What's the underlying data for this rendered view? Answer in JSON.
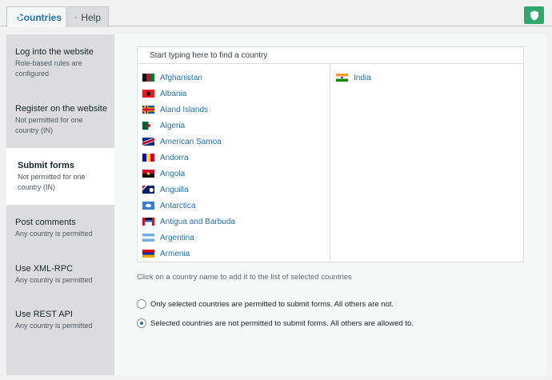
{
  "tabs": {
    "countries_label": "Countries",
    "help_label": "Help"
  },
  "sidebar": {
    "items": [
      {
        "title": "Log into the website",
        "subtitle": "Role-based rules are configured"
      },
      {
        "title": "Register on the website",
        "subtitle": "Not permitted for one country (IN)"
      },
      {
        "title": "Submit forms",
        "subtitle": "Not permitted for one country (IN)"
      },
      {
        "title": "Post comments",
        "subtitle": "Any country is permitted"
      },
      {
        "title": "Use XML-RPC",
        "subtitle": "Any country is permitted"
      },
      {
        "title": "Use REST API",
        "subtitle": "Any country is permitted"
      }
    ],
    "active_index": 2
  },
  "selector": {
    "search_placeholder": "Start typing here to find a country",
    "available": [
      {
        "name": "Afghanistan",
        "flag": "af"
      },
      {
        "name": "Albania",
        "flag": "al"
      },
      {
        "name": "Aland Islands",
        "flag": "ax"
      },
      {
        "name": "Algeria",
        "flag": "dz"
      },
      {
        "name": "American Samoa",
        "flag": "as"
      },
      {
        "name": "Andorra",
        "flag": "ad"
      },
      {
        "name": "Angola",
        "flag": "ao"
      },
      {
        "name": "Anguilla",
        "flag": "ai"
      },
      {
        "name": "Antarctica",
        "flag": "aq"
      },
      {
        "name": "Antigua and Barbuda",
        "flag": "ag"
      },
      {
        "name": "Argentina",
        "flag": "ar"
      },
      {
        "name": "Armenia",
        "flag": "am"
      }
    ],
    "selected": [
      {
        "name": "India",
        "flag": "in"
      }
    ]
  },
  "hint": "Click on a country name to add it to the list of selected countries",
  "options": [
    {
      "label": "Only selected countries are permitted to submit forms. All others are not.",
      "checked": false
    },
    {
      "label": "Selected countries are not permitted to submit forms. All others are allowed to.",
      "checked": true
    }
  ],
  "colors": {
    "accent": "#2271b1",
    "shield": "#2ea96b"
  }
}
